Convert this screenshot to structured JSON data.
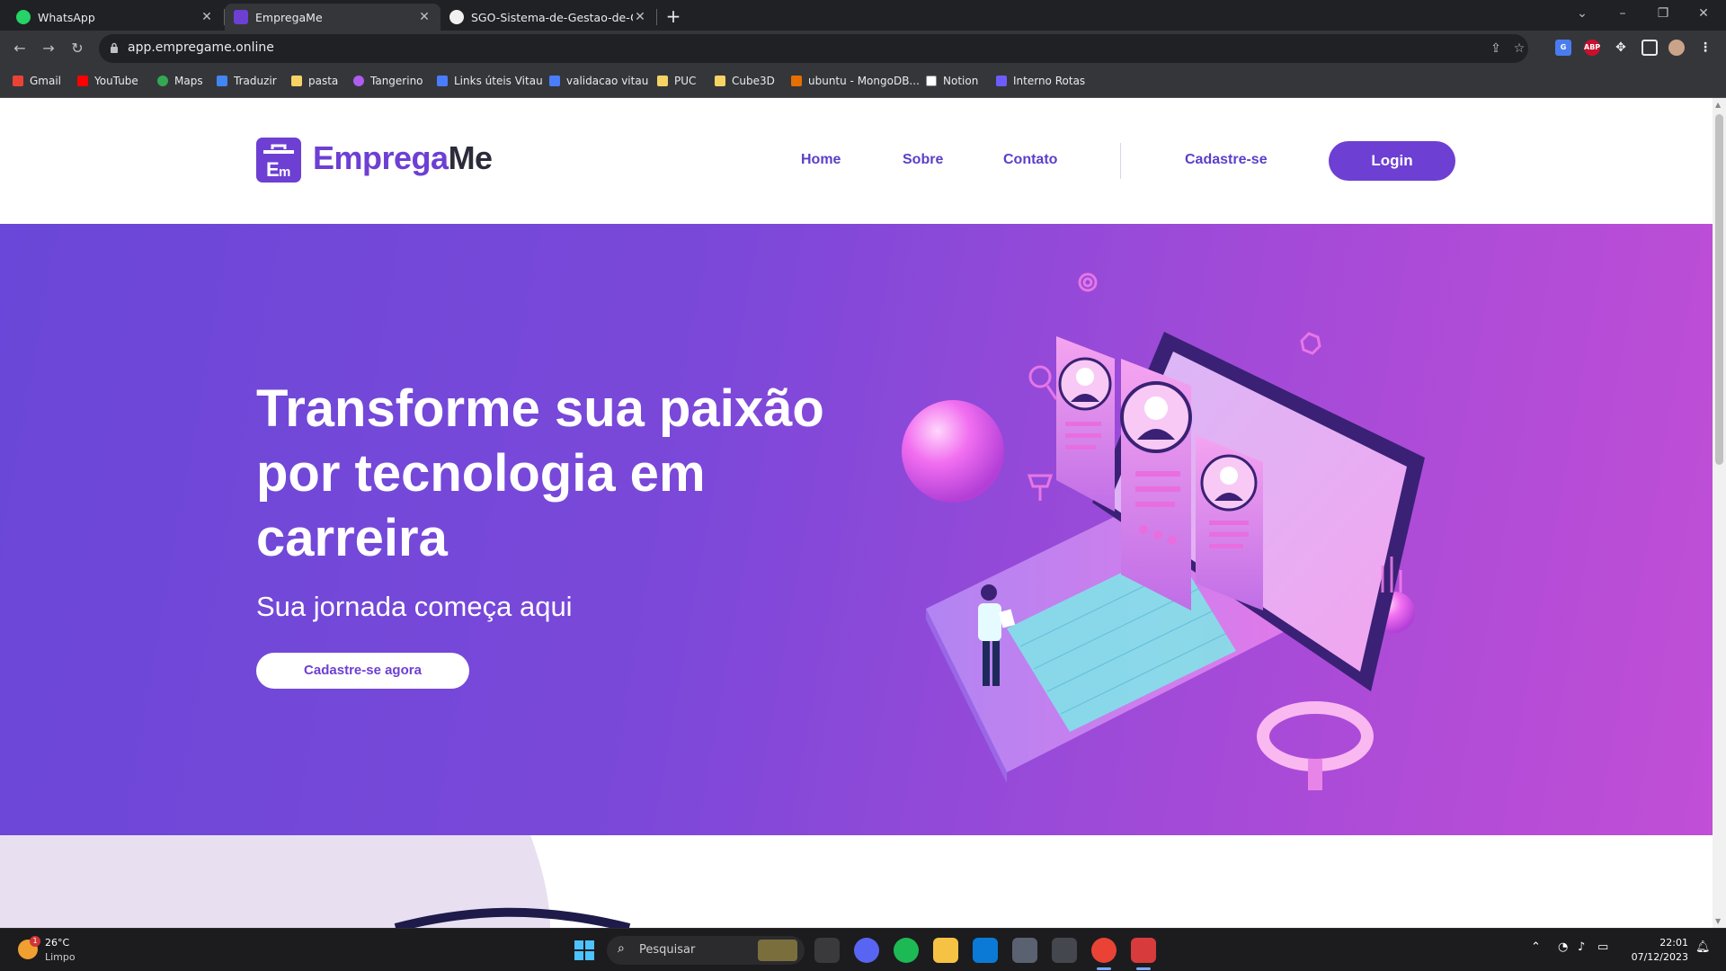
{
  "browser": {
    "tabs": [
      {
        "title": "WhatsApp",
        "favicon": "whatsapp-icon",
        "active": false
      },
      {
        "title": "EmpregaMe",
        "favicon": "emprega-me-icon",
        "active": true
      },
      {
        "title": "SGO-Sistema-de-Gestao-de-ON",
        "favicon": "github-icon",
        "active": false
      }
    ],
    "url": "app.empregame.online",
    "bookmarks": [
      {
        "label": "Gmail",
        "icon": "gmail-icon",
        "color": "#ea4335"
      },
      {
        "label": "YouTube",
        "icon": "youtube-icon",
        "color": "#ff0000"
      },
      {
        "label": "Maps",
        "icon": "maps-icon",
        "color": "#34a853"
      },
      {
        "label": "Traduzir",
        "icon": "translate-icon",
        "color": "#4285f4"
      },
      {
        "label": "pasta",
        "icon": "folder-icon",
        "color": "#f6d365"
      },
      {
        "label": "Tangerino",
        "icon": "tangerino-icon",
        "color": "#b05cf0"
      },
      {
        "label": "Links úteis Vitau",
        "icon": "vitau-icon",
        "color": "#4a7cff"
      },
      {
        "label": "validacao vitau",
        "icon": "vitau-icon",
        "color": "#4a7cff"
      },
      {
        "label": "PUC",
        "icon": "folder-icon",
        "color": "#f6d365"
      },
      {
        "label": "Cube3D",
        "icon": "folder-icon",
        "color": "#f6d365"
      },
      {
        "label": "ubuntu - MongoDB...",
        "icon": "java-icon",
        "color": "#e76f00"
      },
      {
        "label": "Notion",
        "icon": "notion-icon",
        "color": "#ffffff"
      },
      {
        "label": "Interno Rotas",
        "icon": "rotas-icon",
        "color": "#6d5cff"
      }
    ]
  },
  "site": {
    "brand": {
      "part1": "Emprega",
      "part2": "Me",
      "badge": "Em",
      "primary_color": "#6d3fd3"
    },
    "nav": {
      "home": "Home",
      "sobre": "Sobre",
      "contato": "Contato",
      "cadastre": "Cadastre-se",
      "login": "Login"
    },
    "hero": {
      "title": "Transforme sua paixão por tecnologia em carreira",
      "subtitle": "Sua jornada começa aqui",
      "cta": "Cadastre-se agora"
    }
  },
  "taskbar": {
    "weather": {
      "temp": "26°C",
      "condition": "Limpo",
      "badge": "1"
    },
    "search_placeholder": "Pesquisar",
    "time": "22:01",
    "date": "07/12/2023",
    "apps": [
      "windows-start-icon",
      "task-view-icon",
      "discord-icon",
      "spotify-icon",
      "file-explorer-icon",
      "vscode-icon",
      "calculator-icon",
      "audio-app-icon",
      "chrome-icon",
      "snipping-tool-icon"
    ]
  }
}
